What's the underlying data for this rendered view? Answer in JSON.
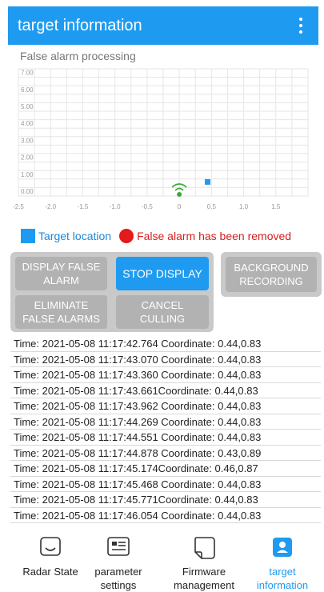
{
  "header": {
    "title": "target information",
    "menu_icon": "more-vert-icon"
  },
  "section": {
    "subtitle": "False alarm processing"
  },
  "chart_data": {
    "type": "scatter",
    "x_ticks": [
      "-2.5",
      "-2.0",
      "-1.5",
      "-1.0",
      "-0.5",
      "0",
      "0.5",
      "1.0",
      "1.5"
    ],
    "y_ticks": [
      "7.00",
      "6.00",
      "5.00",
      "4.00",
      "3.00",
      "2.00",
      "1.00",
      "0.00"
    ],
    "xlim": [
      -2.5,
      2.0
    ],
    "ylim": [
      0,
      7.5
    ],
    "grid": true,
    "radar_origin": {
      "x": 0,
      "y": 0,
      "icon": "radar-signal-icon"
    },
    "series": [
      {
        "name": "Target location",
        "color": "#1e9bf0",
        "points": [
          [
            0.44,
            0.83
          ]
        ]
      }
    ]
  },
  "legend": {
    "target_label": "Target location",
    "target_color": "#1e9bf0",
    "removed_label": "False alarm has been removed",
    "removed_color": "#e31b1b"
  },
  "buttons": {
    "display_false_alarm": "DISPLAY FALSE ALARM",
    "stop_display": "STOP DISPLAY",
    "background_recording": "BACKGROUND RECORDING",
    "eliminate_false_alarms": "ELIMINATE FALSE ALARMS",
    "cancel_culling": "CANCEL CULLING"
  },
  "log": [
    "Time: 2021-05-08 11:17:42.764 Coordinate: 0.44,0.83",
    "Time: 2021-05-08 11:17:43.070 Coordinate: 0.44,0.83",
    "Time: 2021-05-08 11:17:43.360 Coordinate: 0.44,0.83",
    "Time: 2021-05-08 11:17:43.661Coordinate: 0.44,0.83",
    "Time: 2021-05-08 11:17:43.962 Coordinate: 0.44,0.83",
    "Time: 2021-05-08 11:17:44.269 Coordinate: 0.44,0.83",
    "Time: 2021-05-08 11:17:44.551 Coordinate: 0.44,0.83",
    "Time: 2021-05-08 11:17:44.878 Coordinate: 0.43,0.89",
    "Time: 2021-05-08 11:17:45.174Coordinate: 0.46,0.87",
    "Time: 2021-05-08 11:17:45.468 Coordinate: 0.44,0.83",
    "Time: 2021-05-08 11:17:45.771Coordinate: 0.44,0.83",
    "Time: 2021-05-08 11:17:46.054 Coordinate: 0.44,0.83"
  ],
  "nav": {
    "radar_state": "Radar State",
    "parameter_settings": "parameter settings",
    "firmware_management": "Firmware management",
    "target_information": "target information",
    "active_color": "#1e9bf0"
  }
}
